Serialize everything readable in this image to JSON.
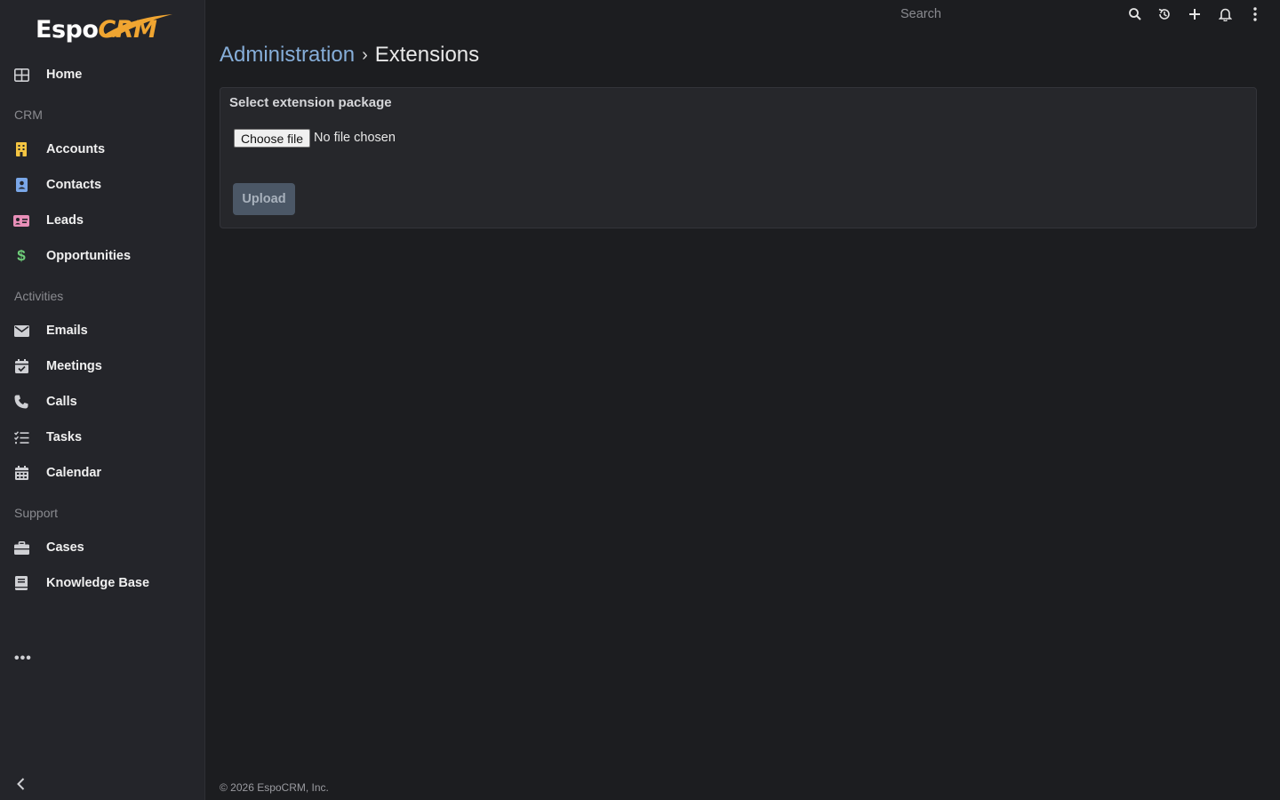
{
  "app": {
    "logo_main": "Espo",
    "logo_accent": "CRM"
  },
  "sidebar": {
    "items": [
      {
        "label": "Home",
        "icon": "home-grid-icon"
      },
      {
        "label": "Accounts",
        "icon": "building-icon",
        "color": "#f5c542"
      },
      {
        "label": "Contacts",
        "icon": "contact-card-icon",
        "color": "#7aa7e8"
      },
      {
        "label": "Leads",
        "icon": "id-card-icon",
        "color": "#e88fb8"
      },
      {
        "label": "Opportunities",
        "icon": "dollar-icon",
        "color": "#6fcf7a"
      },
      {
        "label": "Emails",
        "icon": "envelope-icon"
      },
      {
        "label": "Meetings",
        "icon": "calendar-check-icon"
      },
      {
        "label": "Calls",
        "icon": "phone-icon"
      },
      {
        "label": "Tasks",
        "icon": "list-check-icon"
      },
      {
        "label": "Calendar",
        "icon": "calendar-grid-icon"
      },
      {
        "label": "Cases",
        "icon": "briefcase-icon"
      },
      {
        "label": "Knowledge Base",
        "icon": "book-icon"
      }
    ],
    "groups": {
      "crm": "CRM",
      "activities": "Activities",
      "support": "Support"
    },
    "more": "•••"
  },
  "topbar": {
    "search_placeholder": "Search",
    "icons": [
      "search-icon",
      "history-icon",
      "plus-icon",
      "bell-icon",
      "kebab-menu-icon"
    ]
  },
  "breadcrumb": {
    "parent": "Administration",
    "separator": "›",
    "current": "Extensions"
  },
  "panel": {
    "title": "Select extension package",
    "choose_file_label": "Choose file",
    "file_status": "No file chosen",
    "upload_label": "Upload"
  },
  "footer": {
    "text": "© 2026 EspoCRM, Inc."
  },
  "colors": {
    "accent": "#86aed9",
    "background": "#1c1d20",
    "sidebar": "#24252a",
    "logo_accent": "#f0a531"
  }
}
